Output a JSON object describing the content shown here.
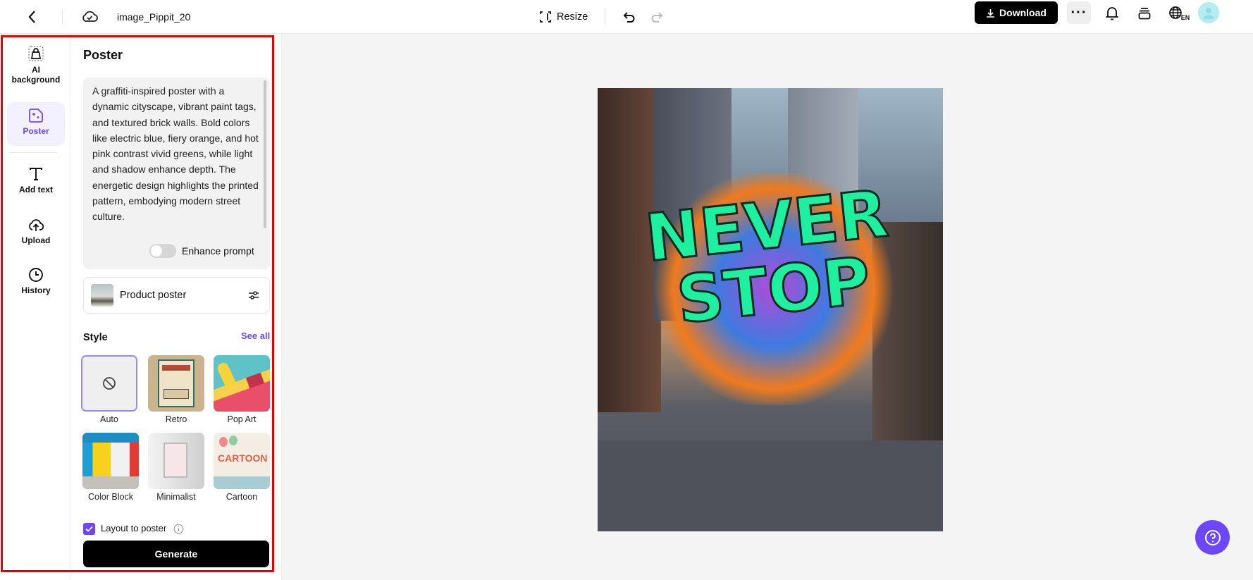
{
  "topbar": {
    "filename": "image_Pippit_20",
    "resize_label": "Resize",
    "download_label": "Download",
    "language": "EN"
  },
  "sidebar": {
    "items": [
      {
        "label": "AI background"
      },
      {
        "label": "Poster"
      },
      {
        "label": "Add text"
      },
      {
        "label": "Upload"
      },
      {
        "label": "History"
      }
    ]
  },
  "panel": {
    "title": "Poster",
    "prompt": "A graffiti-inspired poster with a dynamic cityscape, vibrant paint tags, and textured brick walls. Bold colors like electric blue, fiery orange, and hot pink contrast vivid greens, while light and shadow enhance depth. The energetic design highlights the printed pattern, embodying modern street culture.",
    "enhance_label": "Enhance prompt",
    "enhance_on": false,
    "template_label": "Product poster",
    "style_heading": "Style",
    "see_all": "See all",
    "styles": [
      {
        "label": "Auto"
      },
      {
        "label": "Retro"
      },
      {
        "label": "Pop Art"
      },
      {
        "label": "Color Block"
      },
      {
        "label": "Minimalist"
      },
      {
        "label": "Cartoon"
      }
    ],
    "layout_label": "Layout to poster",
    "layout_checked": true,
    "generate_label": "Generate"
  },
  "canvas": {
    "poster_text_1": "NEVER",
    "poster_text_2": "STOP"
  },
  "colors": {
    "accent": "#6c47ff",
    "highlight": "#e60000"
  }
}
